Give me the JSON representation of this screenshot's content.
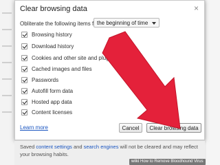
{
  "dialog": {
    "title": "Clear browsing data",
    "close_glyph": "×",
    "obliterate_label": "Obliterate the following items from:",
    "time_range": {
      "selected": "the beginning of time"
    },
    "options": [
      {
        "label": "Browsing history",
        "checked": true
      },
      {
        "label": "Download history",
        "checked": true
      },
      {
        "label": "Cookies and other site and plug-in data",
        "checked": true
      },
      {
        "label": "Cached images and files",
        "checked": true
      },
      {
        "label": "Passwords",
        "checked": true
      },
      {
        "label": "Autofill form data",
        "checked": true
      },
      {
        "label": "Hosted app data",
        "checked": true
      },
      {
        "label": "Content licenses",
        "checked": true
      }
    ],
    "learn_more": "Learn more",
    "cancel_label": "Cancel",
    "clear_label": "Clear browsing data"
  },
  "footer": {
    "saved_prefix": "Saved ",
    "content_settings": "content settings",
    "and_text": " and ",
    "search_engines": "search engines",
    "suffix": " will not be cleared and may reflect your browsing habits."
  },
  "watermark": {
    "prefix": "wiki",
    "text": "How to Remove Bloodhound Virus"
  },
  "colors": {
    "arrow": "#e4213a",
    "link": "#1a55c0"
  }
}
